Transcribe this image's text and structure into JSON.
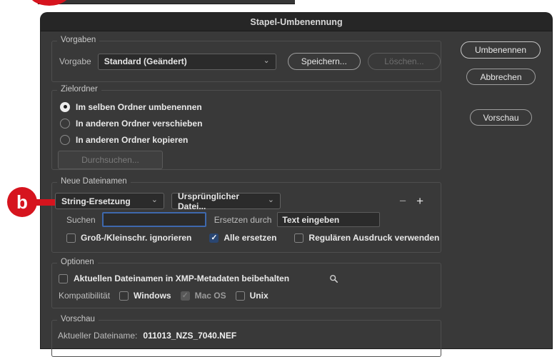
{
  "annotations": {
    "badge_label": "b",
    "accent_color": "#d6141e"
  },
  "icons": {
    "chevron_down": "⌄",
    "minus": "−",
    "plus": "+",
    "check": "✓",
    "magnifier": "magnifier-loupe"
  },
  "dialog": {
    "title": "Stapel-Umbenennung",
    "actions": {
      "rename": "Umbenennen",
      "cancel": "Abbrechen",
      "preview": "Vorschau"
    },
    "presets": {
      "legend": "Vorgaben",
      "label": "Vorgabe",
      "value": "Standard (Geändert)",
      "save": "Speichern...",
      "delete": "Löschen..."
    },
    "destination": {
      "legend": "Zielordner",
      "options": [
        {
          "label": "Im selben Ordner umbenennen",
          "selected": true
        },
        {
          "label": "In anderen Ordner verschieben",
          "selected": false
        },
        {
          "label": "In anderen Ordner kopieren",
          "selected": false
        }
      ],
      "browse": "Durchsuchen..."
    },
    "filenames": {
      "legend": "Neue Dateinamen",
      "method": "String-Ersetzung",
      "source": "Ursprünglicher Datei...",
      "find_label": "Suchen",
      "find_value": "",
      "replace_label": "Ersetzen durch",
      "replace_value": "Text eingeben",
      "checkboxes": [
        {
          "label": "Groß-/Kleinschr. ignorieren",
          "checked": false
        },
        {
          "label": "Alle ersetzen",
          "checked": true
        },
        {
          "label": "Regulären Ausdruck verwenden",
          "checked": false
        }
      ]
    },
    "options": {
      "legend": "Optionen",
      "xmp_label": "Aktuellen Dateinamen in XMP-Metadaten beibehalten",
      "compat_label": "Kompatibilität",
      "compat": [
        {
          "label": "Windows",
          "checked": false,
          "disabled": false
        },
        {
          "label": "Mac OS",
          "checked": true,
          "disabled": true
        },
        {
          "label": "Unix",
          "checked": false,
          "disabled": false
        }
      ]
    },
    "preview": {
      "legend": "Vorschau",
      "current_label": "Aktueller Dateiname:",
      "current_value": "011013_NZS_7040.NEF"
    },
    "colors": {
      "dialog_bg": "#393939",
      "titlebar_bg": "#262626",
      "focus_blue": "#3e68ad",
      "checked_blue": "#2a4671"
    }
  }
}
